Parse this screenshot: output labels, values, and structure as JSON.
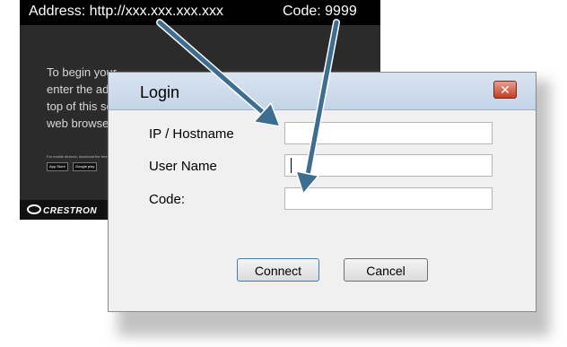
{
  "background_screen": {
    "address_text": "Address:  http://xxx.xxx.xxx.xxx",
    "code_text": "Code:  9999",
    "instructions": "To begin your\nenter  the add\ntop of this sc\nweb browser.",
    "mobile_note": "For mobile devices, download the free",
    "app_store_label": "App Store",
    "google_play_label": "Google play",
    "logo_text": "CRESTRON"
  },
  "dialog": {
    "title": "Login",
    "close_glyph": "✕",
    "fields": {
      "host_label": "IP / Hostname",
      "host_value": "",
      "user_label": "User Name",
      "user_value": "",
      "code_label": "Code:",
      "code_value": ""
    },
    "buttons": {
      "connect": "Connect",
      "cancel": "Cancel"
    }
  },
  "colors": {
    "arrow": "#3d6e91",
    "close_button": "#c43d1f",
    "titlebar": "#c4d4e8"
  }
}
